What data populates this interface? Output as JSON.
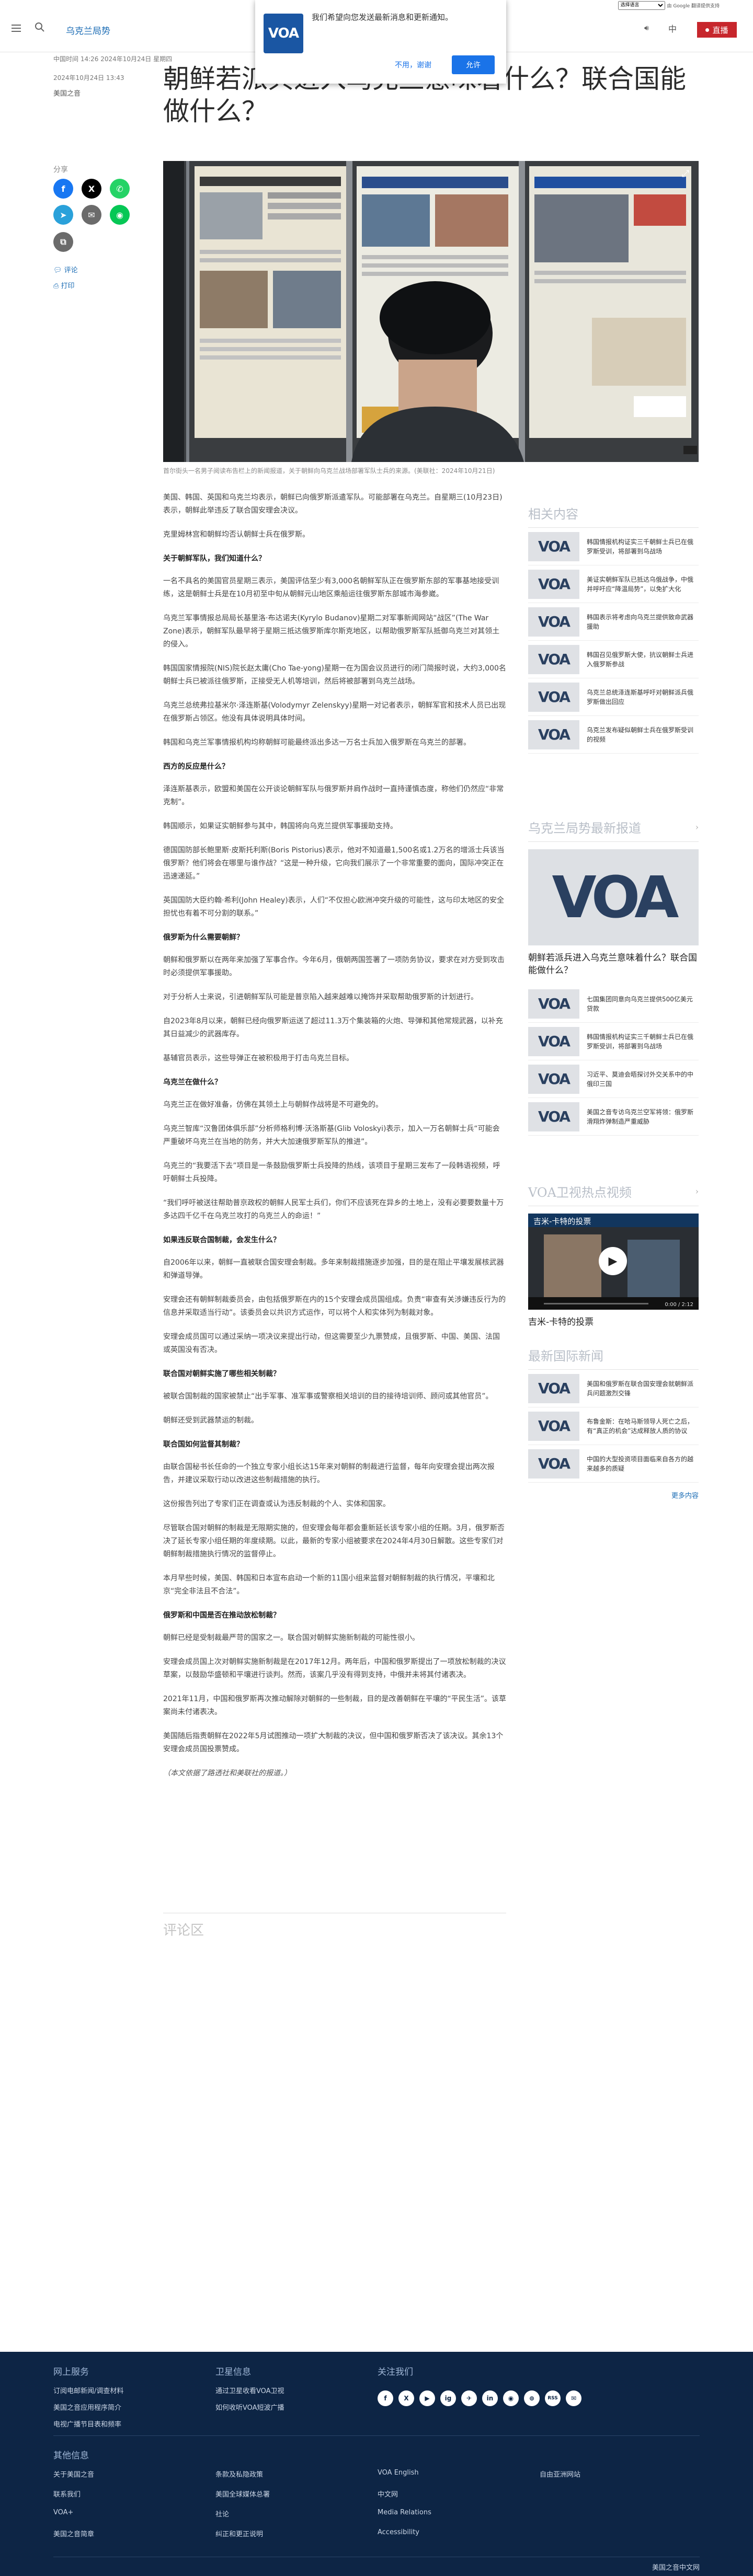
{
  "translate": {
    "label": "选择语言",
    "powered": "由 Google 翻译提供支持"
  },
  "header": {
    "section": "乌克兰局势",
    "live": "直播",
    "lang": "中"
  },
  "popup": {
    "logo": "VOA",
    "message": "我们希望向您发送最新消息和更新通知。",
    "decline": "不用，谢谢",
    "accept": "允许"
  },
  "article": {
    "published": "中国时间 14:26 2024年10月24日 星期四",
    "updated": "2024年10月24日 13:43",
    "tag": "美国之音",
    "title": "朝鲜若派兵进入乌克兰意味着什么？联合国能做什么？",
    "caption": "首尔街头一名男子阅读布告栏上的新闻报道，关于朝鲜向乌克兰战场部署军队士兵的来源。(美联社：2024年10月21日)",
    "paragraphs": [
      {
        "type": "p",
        "text": "美国、韩国、英国和乌克兰均表示，朝鲜已向俄罗斯派遣军队。可能部署在乌克兰。自星期三(10月23日)表示，朝鲜此举违反了联合国安理会决议。"
      },
      {
        "type": "p",
        "text": "克里姆林宫和朝鲜均否认朝鲜士兵在俄罗斯。"
      },
      {
        "type": "h",
        "text": "关于朝鲜军队，我们知道什么？"
      },
      {
        "type": "p",
        "text": "一名不具名的美国官员星期三表示，美国评估至少有3,000名朝鲜军队正在俄罗斯东部的军事基地接受训练，这是朝鲜士兵是在10月初至中旬从朝鲜元山地区乘船运往俄罗斯东部城市海参崴。"
      },
      {
        "type": "p",
        "text": "乌克兰军事情报总局局长基里洛·布达诺夫(Kyrylo Budanov)星期二对军事新闻网站“战区”(The War Zone)表示，朝鲜军队最早将于星期三抵达俄罗斯库尔斯克地区，以帮助俄罗斯军队抵御乌克兰对其领土的侵入。"
      },
      {
        "type": "p",
        "text": "韩国国家情报院(NIS)院长赵太庸(Cho Tae-yong)星期一在为国会议员进行的闭门简报时说，大约3,000名朝鲜士兵已被派往俄罗斯，正接受无人机等培训，然后将被部署到乌克兰战场。"
      },
      {
        "type": "p",
        "text": "乌克兰总统弗拉基米尔·泽连斯基(Volodymyr Zelenskyy)星期一对记者表示，朝鲜军官和技术人员已出现在俄罗斯占领区。他没有具体说明具体时间。"
      },
      {
        "type": "p",
        "text": "韩国和乌克兰军事情报机构均称朝鲜可能最终派出多达一万名士兵加入俄罗斯在乌克兰的部署。"
      },
      {
        "type": "h",
        "text": "西方的反应是什么？"
      },
      {
        "type": "p",
        "text": "泽连斯基表示，欧盟和美国在公开谈论朝鲜军队与俄罗斯并肩作战时一直持谨慎态度，称他们仍然应“非常克制”。"
      },
      {
        "type": "p",
        "text": "韩国顺示，如果证实朝鲜参与其中，韩国将向乌克兰提供军事援助支持。"
      },
      {
        "type": "p",
        "text": "德国国防部长鲍里斯·皮斯托利斯(Boris Pistorius)表示，他对不知道最1,500名或1.2万名的增派士兵该当俄罗斯？他们将会在哪里与谁作战？“这是一种升级，它向我们展示了一个非常重要的面向，国际冲突正在迅速递延。”"
      },
      {
        "type": "p",
        "text": "英国国防大臣约翰·希利(John Healey)表示，人们“不仅担心欧洲冲突升级的可能性，这与印太地区的安全担忧也有着不可分割的联系。”"
      },
      {
        "type": "h",
        "text": "俄罗斯为什么需要朝鲜？"
      },
      {
        "type": "p",
        "text": "朝鲜和俄罗斯以在两年来加强了军事合作。今年6月，俄朝两国签署了一项防务协议，要求在对方受到攻击时必须提供军事援助。"
      },
      {
        "type": "p",
        "text": "对于分析人士来说，引进朝鲜军队可能是普京陷入越来越难以掩饰并采取帮助俄罗斯的计划进行。"
      },
      {
        "type": "p",
        "text": "自2023年8月以来，朝鲜已经向俄罗斯运送了超过11.3万个集装箱的火炮、导弹和其他常规武器，以补充其日益减少的武器库存。"
      },
      {
        "type": "p",
        "text": "基辅官员表示，这些导弹正在被积极用于打击乌克兰目标。"
      },
      {
        "type": "h",
        "text": "乌克兰在做什么？"
      },
      {
        "type": "p",
        "text": "乌克兰正在做好准备，仿佛在其领土上与朝鲜作战将是不可避免的。"
      },
      {
        "type": "p",
        "text": "乌克兰智库“汉鲁团体俱乐部”分析师格利博·沃洛斯基(Glib Voloskyi)表示，加入一万名朝鲜士兵“可能会严重破坏乌克兰在当地的防务，并大大加速俄罗斯军队的推进”。"
      },
      {
        "type": "p",
        "text": "乌克兰的“我要活下去”项目是一条鼓励俄罗斯士兵投降的热线，该项目于星期三发布了一段韩语视频，呼吁朝鲜士兵投降。"
      },
      {
        "type": "p",
        "text": "“我们呼吁被送往帮助普京政权的朝鲜人民军士兵们，你们不应该死在异乡的土地上，没有必要要数量十万多达四千亿千在乌克兰攻打的乌克兰人的命运！”"
      },
      {
        "type": "h",
        "text": "如果违反联合国制裁，会发生什么？"
      },
      {
        "type": "p",
        "text": "自2006年以来，朝鲜一直被联合国安理会制裁。多年来制裁措施逐步加强，目的是在阻止平壤发展核武器和弹道导弹。"
      },
      {
        "type": "p",
        "text": "安理会还有朝鲜制裁委员会，由包括俄罗斯在内的15个安理会成员国组成。负责“审查有关涉嫌违反行为的信息并采取适当行动”。该委员会以共识方式运作，可以将个人和实体列为制裁对象。"
      },
      {
        "type": "p",
        "text": "安理会成员国可以通过采纳一项决议来提出行动，但这需要至少九票赞成，且俄罗斯、中国、美国、法国或英国没有否决。"
      },
      {
        "type": "h",
        "text": "联合国对朝鲜实施了哪些相关制裁？"
      },
      {
        "type": "p",
        "text": "被联合国制裁的国家被禁止“出手军事、准军事或警察相关培训的目的接待培训师、顾问或其他官员”。"
      },
      {
        "type": "p",
        "text": "朝鲜还受到武器禁运的制裁。"
      },
      {
        "type": "h",
        "text": "联合国如何监督其制裁？"
      },
      {
        "type": "p",
        "text": "由联合国秘书长任命的一个独立专家小组长达15年来对朝鲜的制裁进行监督，每年向安理会提出两次报告，并建议采取行动以改进这些制裁措施的执行。"
      },
      {
        "type": "p",
        "text": "这份报告列出了专家们正在调查或认为违反制裁的个人、实体和国家。"
      },
      {
        "type": "p",
        "text": "尽管联合国对朝鲜的制裁是无限期实施的，但安理会每年都会重新延长该专家小组的任期。3月，俄罗斯否决了延长专家小组任期的年度续期。以此，最新的专家小组被要求在2024年4月30日解散。这些专家们对朝鲜制裁措施执行情况的监督停止。"
      },
      {
        "type": "p",
        "text": "本月早些时候，美国、韩国和日本宣布启动一个新的11国小组来监督对朝鲜制裁的执行情况，平壤和北京“完全非法且不合法”。"
      },
      {
        "type": "h",
        "text": "俄罗斯和中国是否在推动放松制裁？"
      },
      {
        "type": "p",
        "text": "朝鲜已经是受制裁最严苛的国家之一。联合国对朝鲜实施新制裁的可能性很小。"
      },
      {
        "type": "p",
        "text": "安理会成员国上次对朝鲜实施新制裁是在2017年12月。两年后，中国和俄罗斯提出了一项放松制裁的决议草案，以鼓励华盛顿和平壤进行谈判。然而，该案几乎没有得到支持，中俄并未将其付诸表决。"
      },
      {
        "type": "p",
        "text": "2021年11月，中国和俄罗斯再次推动解除对朝鲜的一些制裁，目的是改善朝鲜在平壤的“平民生活”。该草案尚未付诸表决。"
      },
      {
        "type": "p",
        "text": "美国随后指责朝鲜在2022年5月试图推动一项扩大制裁的决议，但中国和俄罗斯否决了该决议。其余13个安理会成员国投票赞成。"
      },
      {
        "type": "credit",
        "text": "（本文依据了路透社和美联社的报道。）"
      }
    ]
  },
  "share": {
    "label": "分享",
    "comment": "评论",
    "print": "打印"
  },
  "comments_title": "评论区",
  "related": {
    "title": "相关内容",
    "items": [
      "韩国情报机构证实三千朝鲜士兵已在俄罗斯受训，将部署到乌战场",
      "美证实朝鲜军队已抵达乌俄战争，中俄并呼吁应“降温局势”，以免扩大化",
      "韩国表示将考虑向乌克兰提供致命武器援助",
      "韩国召见俄罗斯大使，抗议朝鲜士兵进入俄罗斯参战",
      "乌克兰总统泽连斯基呼吁对朝鲜派兵俄罗斯做出回应",
      "乌克兰发布疑似朝鲜士兵在俄罗斯受训的视频"
    ]
  },
  "latest_ukraine": {
    "title": "乌克兰局势最新报道",
    "headline": "朝鲜若派兵进入乌克兰意味着什么？联合国能做什么？",
    "items": [
      "七国集团同意向乌克兰提供500亿美元贷款",
      "韩国情报机构证实三千朝鲜士兵已在俄罗斯受训，将部署到乌战场",
      "习近平、莫迪会晤探讨外交关系中的中俄印三国",
      "美国之音专访乌克兰空军将领：俄罗斯滑翔炸弹制造严重威胁"
    ]
  },
  "video": {
    "title": "VOA卫视热点视频",
    "overlay": "吉米-卡特的投票",
    "caption": "吉米-卡特的投票",
    "time": "0:00 / 2:12"
  },
  "world": {
    "title": "最新国际新闻",
    "items": [
      "美国和俄罗斯在联合国安理会就朝鲜派兵问题激烈交锋",
      "布鲁金斯：在哈马斯领导人死亡之后，有“真正的机会”达成释放人质的协议",
      "中国的大型投资项目面临来自各方的越来越多的质疑"
    ],
    "more": "更多内容"
  },
  "footer": {
    "col1_title": "网上服务",
    "col1": [
      "订阅电邮新闻/调查材料",
      "美国之音应用程序简介",
      "电视广播节目表和频率"
    ],
    "col2_title": "卫星信息",
    "col2": [
      "通过卫星收看VOA卫视",
      "如何收听VOA短波广播"
    ],
    "col3_title": "关注我们",
    "icons": [
      "f",
      "X",
      "▶",
      "ig",
      "✈",
      "in",
      "◉",
      "⊚",
      "RSS",
      "✉"
    ],
    "other_title": "其他信息",
    "links": [
      "关于美国之音",
      "条款及私隐政策",
      "VOA English",
      "自由亚洲网站",
      "联系我们",
      "美国全球媒体总署",
      "中文网",
      "",
      "VOA+",
      "社论",
      "Media Relations",
      "",
      "美国之音简章",
      "纠正和更正说明",
      "Accessibility",
      ""
    ],
    "brand": "美国之音中文网"
  }
}
